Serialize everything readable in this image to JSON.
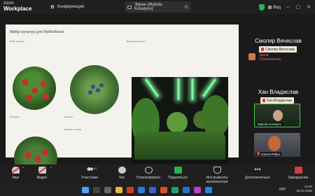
{
  "app": {
    "logo_top": "zoom",
    "logo_bottom": "Workplace"
  },
  "tabs": [
    {
      "label": "Конференция"
    },
    {
      "label": "Экран (Mykola Kovalyov)"
    }
  ],
  "header_right": {
    "view_label": "Вид"
  },
  "slide": {
    "title": "Вибір культур для HydroBoost",
    "left_subtitle": "Ягідні культури",
    "caption_strawberry": "Полуниця",
    "caption_blueberry": "Чорниця",
    "caption_bottom": "Малина та ожина",
    "right_subtitle": "Додаткові культури"
  },
  "participants": {
    "p1_name": "Смоляр Вячеслав",
    "p1_chip": "Смоляр Вячеслав",
    "p1_chip2": "Ірина Соколовська",
    "p2_name": "Хан Владислав",
    "p2_chip": "Хан Владислав",
    "video1_label": "Mykola Kovalyov",
    "video2_label": "Олеся Рябух"
  },
  "toolbar": {
    "audio": "Звук",
    "video": "Видео",
    "participants": "Участники",
    "participants_count": "47",
    "chat": "Чат",
    "react": "Отреагировать",
    "share": "Поделиться",
    "host_tools": "Инструменты организатора",
    "more": "Дополнительно",
    "end": "Завершение"
  },
  "taskbar": {
    "lang": "УКР",
    "time": "16:02",
    "date": "09.12.2025"
  },
  "colors": {
    "share_green": "#29b350",
    "end_red": "#d83b3b",
    "mute_red": "#e03c3c"
  }
}
